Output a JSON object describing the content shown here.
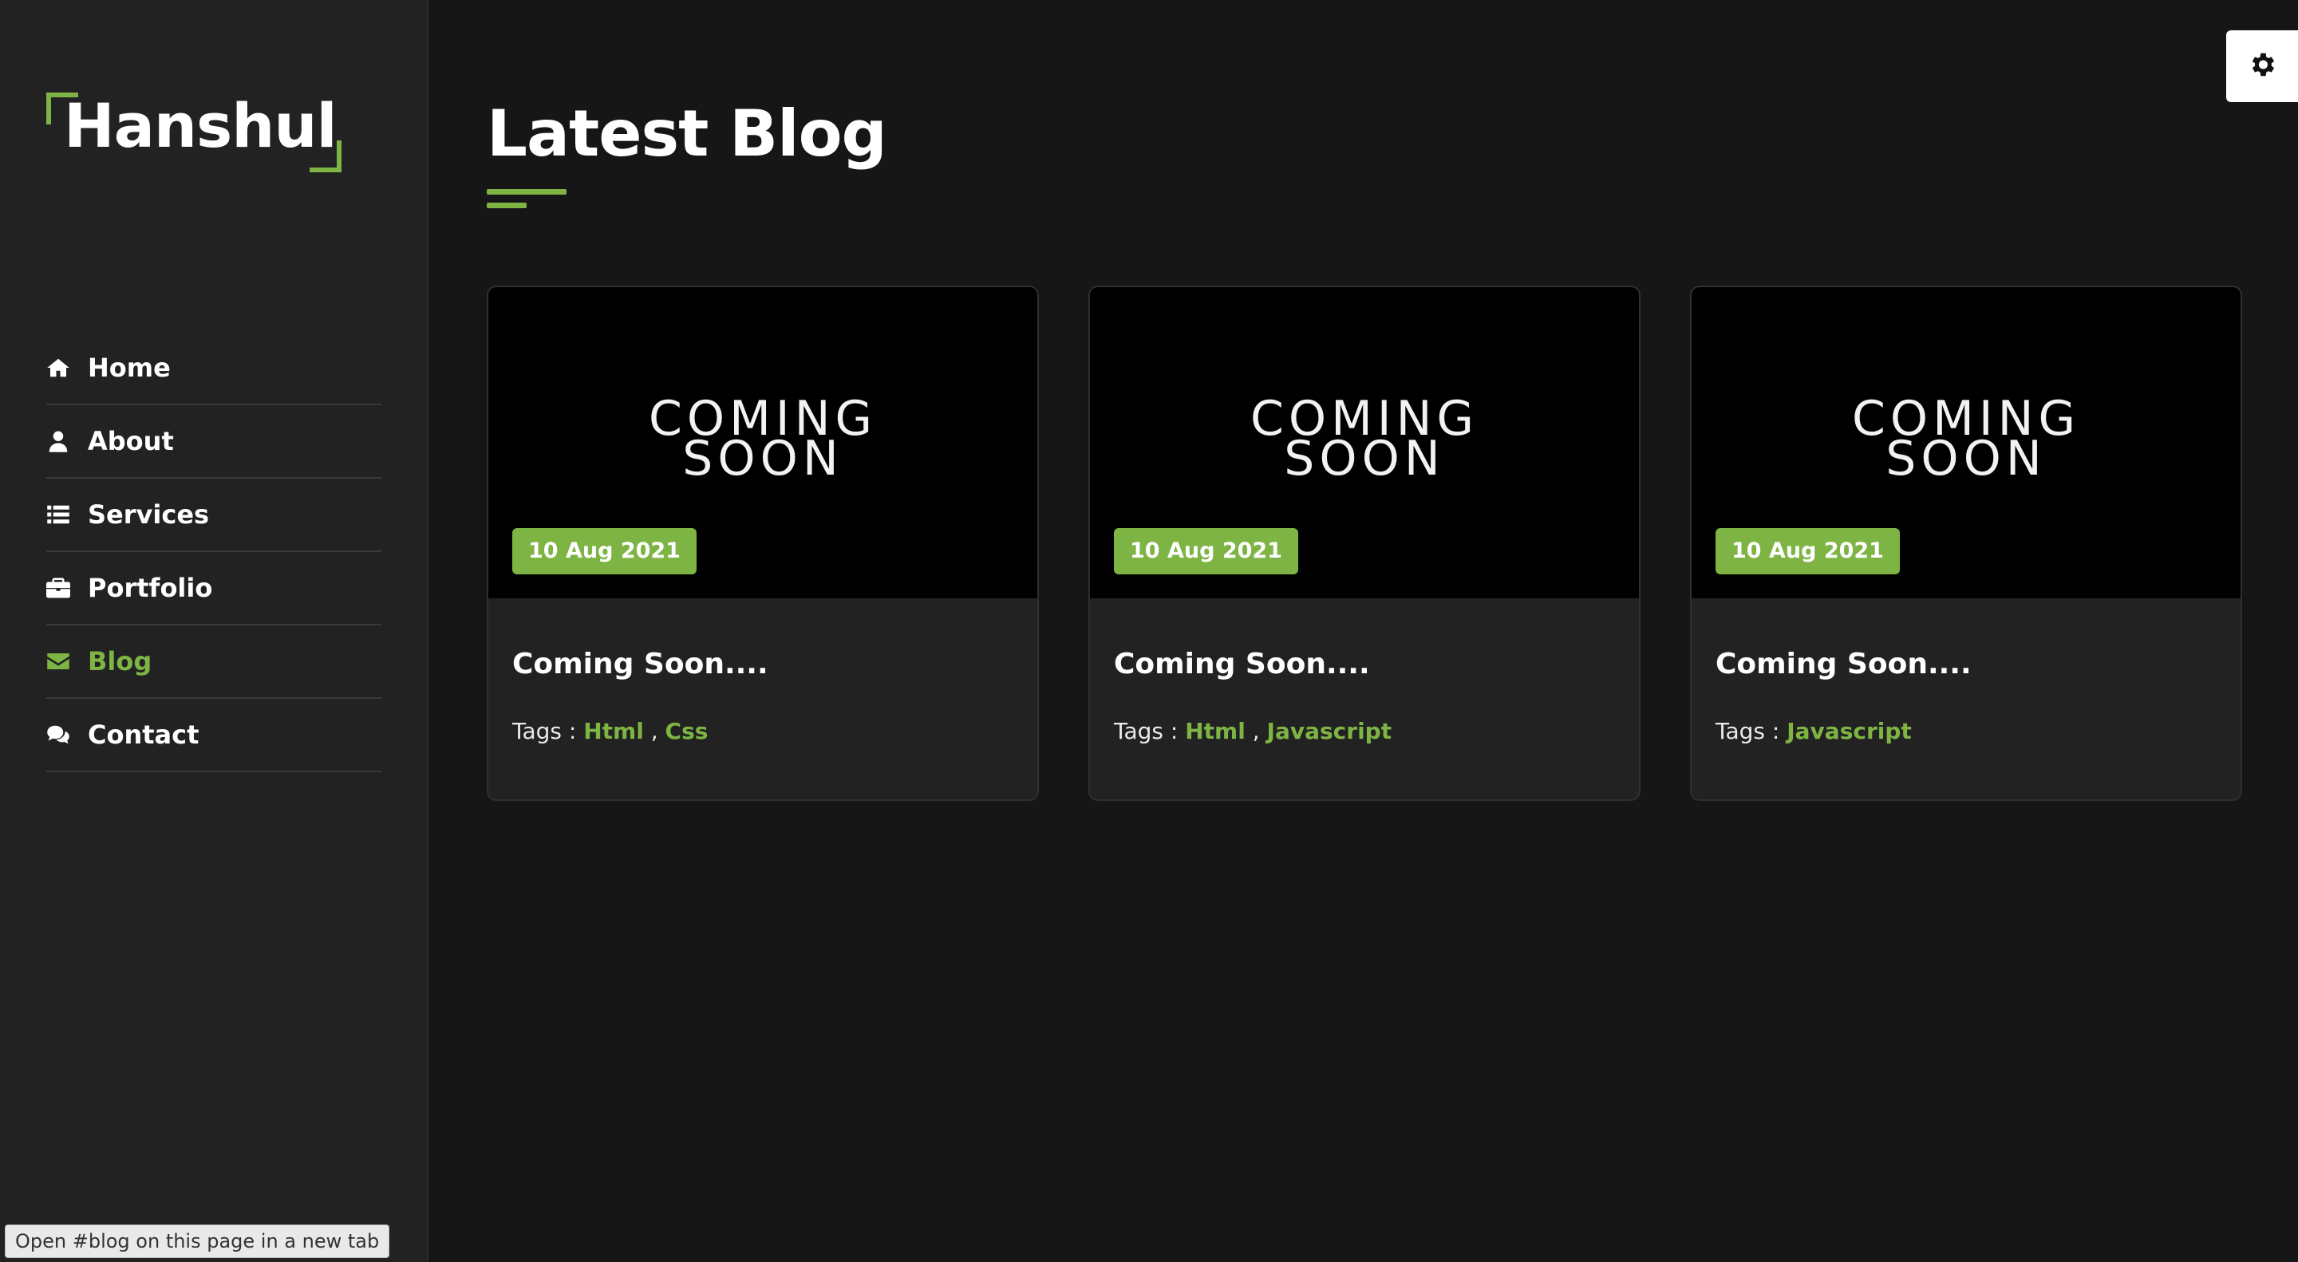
{
  "brand": {
    "name": "Hanshul",
    "accent_color": "#7db443"
  },
  "sidebar": {
    "items": [
      {
        "label": "Home",
        "icon": "home-icon",
        "active": false
      },
      {
        "label": "About",
        "icon": "user-icon",
        "active": false
      },
      {
        "label": "Services",
        "icon": "list-icon",
        "active": false
      },
      {
        "label": "Portfolio",
        "icon": "briefcase-icon",
        "active": false
      },
      {
        "label": "Blog",
        "icon": "envelope-icon",
        "active": true
      },
      {
        "label": "Contact",
        "icon": "comments-icon",
        "active": false
      }
    ]
  },
  "main": {
    "title": "Latest Blog",
    "posts": [
      {
        "image_text_1": "COMING",
        "image_text_2": "SOON",
        "date": "10 Aug 2021",
        "title": "Coming Soon....",
        "tags_label": "Tags :",
        "tag_1": "Html",
        "tag_2": "Css",
        "tags": [
          "Html",
          "Css"
        ]
      },
      {
        "image_text_1": "COMING",
        "image_text_2": "SOON",
        "date": "10 Aug 2021",
        "title": "Coming Soon....",
        "tags_label": "Tags :",
        "tag_1": "Html",
        "tag_2": "Javascript",
        "tags": [
          "Html",
          "Javascript"
        ]
      },
      {
        "image_text_1": "COMING",
        "image_text_2": "SOON",
        "date": "10 Aug 2021",
        "title": "Coming Soon....",
        "tags_label": "Tags :",
        "tag_1": "Javascript",
        "tags": [
          "Javascript"
        ]
      }
    ]
  },
  "settings": {
    "icon": "gear-icon"
  },
  "status_bar": {
    "text": "Open #blog on this page in a new tab"
  }
}
